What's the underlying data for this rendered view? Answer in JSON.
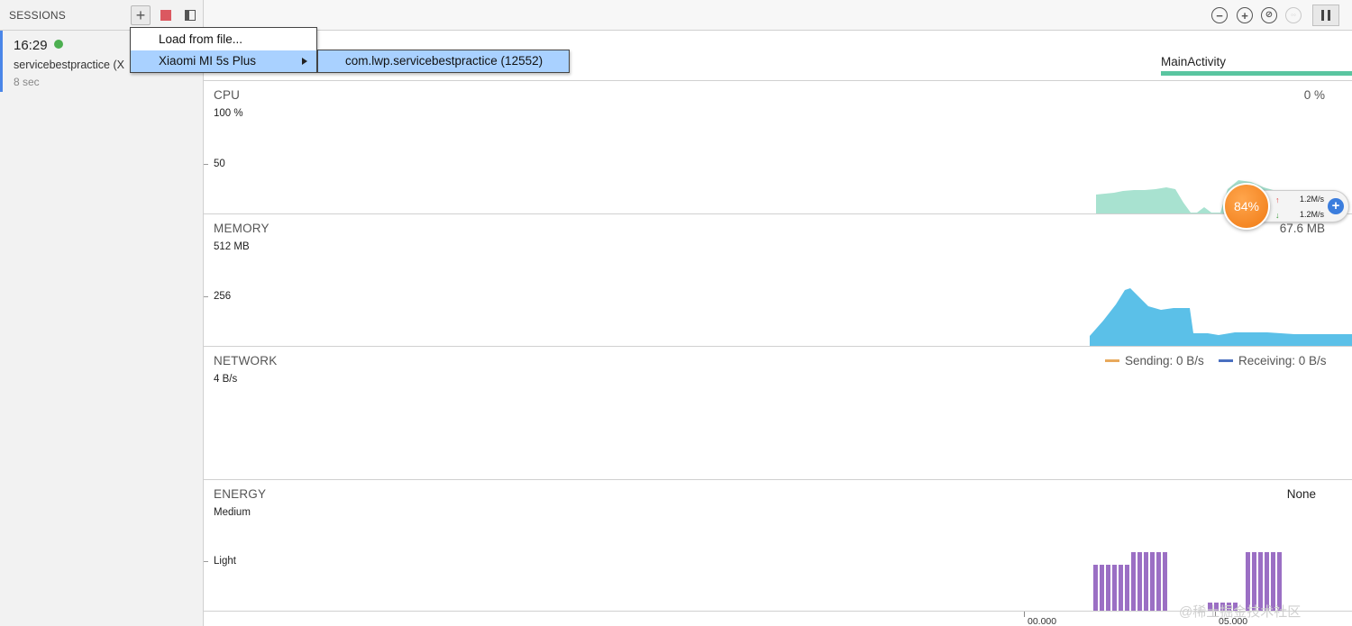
{
  "sessions": {
    "header": "SESSIONS",
    "add_icon": "plus-icon",
    "stop_icon": "stop-icon",
    "panel_icon": "panel-toggle-icon",
    "items": [
      {
        "time": "16:29",
        "name": "servicebestpractice (X",
        "duration": "8 sec",
        "status_color": "#4caf50"
      }
    ]
  },
  "toolbar": {
    "icons": [
      "zoom-out-icon",
      "zoom-in-icon",
      "reset-zoom-icon",
      "attach-live-icon",
      "pause-icon"
    ]
  },
  "menu": {
    "load_from_file": "Load from file...",
    "device": "Xiaomi MI 5s Plus",
    "process": "com.lwp.servicebestpractice (12552)"
  },
  "activity": {
    "label": "MainActivity",
    "color": "#5ac5a0"
  },
  "cpu": {
    "title": "CPU",
    "value": "0 %",
    "max": "100 %",
    "mid": "50",
    "color": "#a8e2d0"
  },
  "memory": {
    "title": "MEMORY",
    "value": "67.6 MB",
    "max": "512 MB",
    "mid": "256",
    "color": "#5bc0e8"
  },
  "network": {
    "title": "NETWORK",
    "max": "4 B/s",
    "sending": "Sending: 0 B/s",
    "receiving": "Receiving: 0 B/s",
    "sending_color": "#e8a95c",
    "receiving_color": "#4a70c0"
  },
  "energy": {
    "title": "ENERGY",
    "value": "None",
    "max": "Medium",
    "mid": "Light",
    "color": "#9b6fc4"
  },
  "speed_widget": {
    "percent": "84%",
    "upload": "1.2M/s",
    "download": "1.2M/s"
  },
  "axis": {
    "labels": [
      "00.000",
      "05.000"
    ]
  },
  "watermark": "@稀土掘金技术社区"
}
